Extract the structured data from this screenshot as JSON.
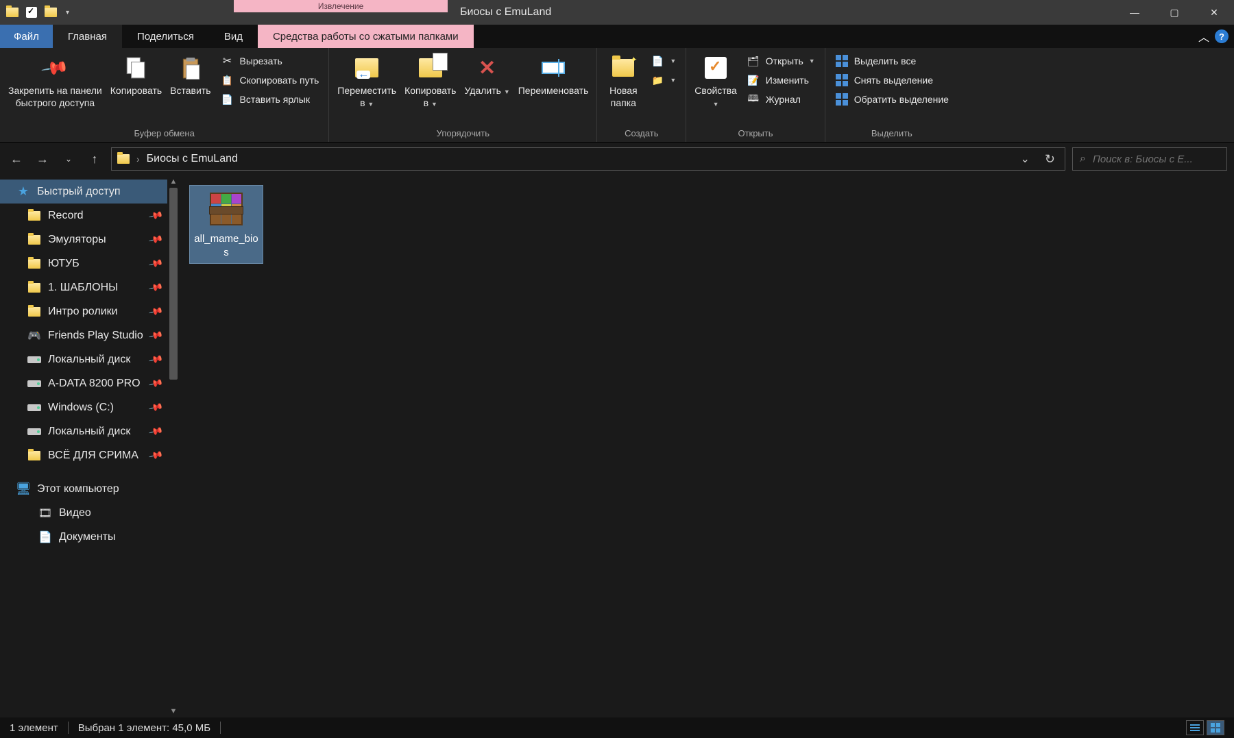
{
  "titlebar": {
    "context_label": "Извлечение",
    "app_title": "Биосы с EmuLand"
  },
  "menu": {
    "file": "Файл",
    "tabs": [
      "Главная",
      "Поделиться",
      "Вид"
    ],
    "context_tab": "Средства работы со сжатыми папками",
    "active_index": 0
  },
  "ribbon": {
    "groups": {
      "clipboard": {
        "label": "Буфер обмена",
        "pin": "Закрепить на панели\nбыстрого доступа",
        "copy": "Копировать",
        "paste": "Вставить",
        "cut": "Вырезать",
        "copypath": "Скопировать путь",
        "pastelink": "Вставить ярлык"
      },
      "organize": {
        "label": "Упорядочить",
        "moveto": "Переместить\nв",
        "copyto": "Копировать\nв",
        "delete": "Удалить",
        "rename": "Переименовать"
      },
      "create": {
        "label": "Создать",
        "newfolder": "Новая\nпапка"
      },
      "open": {
        "label": "Открыть",
        "properties": "Свойства",
        "open": "Открыть",
        "edit": "Изменить",
        "history": "Журнал"
      },
      "select": {
        "label": "Выделить",
        "selectall": "Выделить все",
        "deselect": "Снять выделение",
        "invert": "Обратить выделение"
      }
    }
  },
  "address": {
    "crumb": "Биосы с EmuLand"
  },
  "search": {
    "placeholder": "Поиск в: Биосы с E..."
  },
  "sidebar": {
    "quick_access": "Быстрый доступ",
    "items": [
      {
        "label": "Record",
        "icon": "folder",
        "pinned": true
      },
      {
        "label": "Эмуляторы",
        "icon": "folder",
        "pinned": true
      },
      {
        "label": "ЮТУБ",
        "icon": "folder",
        "pinned": true
      },
      {
        "label": "1. ШАБЛОНЫ",
        "icon": "folder",
        "pinned": true
      },
      {
        "label": "Интро ролики",
        "icon": "folder",
        "pinned": true
      },
      {
        "label": "Friends Play Studio",
        "icon": "special",
        "pinned": true
      },
      {
        "label": "Локальный диск",
        "icon": "drive",
        "pinned": true
      },
      {
        "label": "A-DATA 8200 PRO",
        "icon": "drive",
        "pinned": true
      },
      {
        "label": "Windows (C:)",
        "icon": "drive",
        "pinned": true
      },
      {
        "label": "Локальный диск",
        "icon": "drive",
        "pinned": true
      },
      {
        "label": "ВСЁ ДЛЯ СРИМА",
        "icon": "folder",
        "pinned": true
      }
    ],
    "this_pc": "Этот компьютер",
    "pc_items": [
      {
        "label": "Видео",
        "icon": "lib"
      },
      {
        "label": "Документы",
        "icon": "lib"
      }
    ]
  },
  "files": [
    {
      "name": "all_mame_bios",
      "type": "rar",
      "selected": true
    }
  ],
  "status": {
    "count": "1 элемент",
    "selection": "Выбран 1 элемент: 45,0 МБ"
  }
}
